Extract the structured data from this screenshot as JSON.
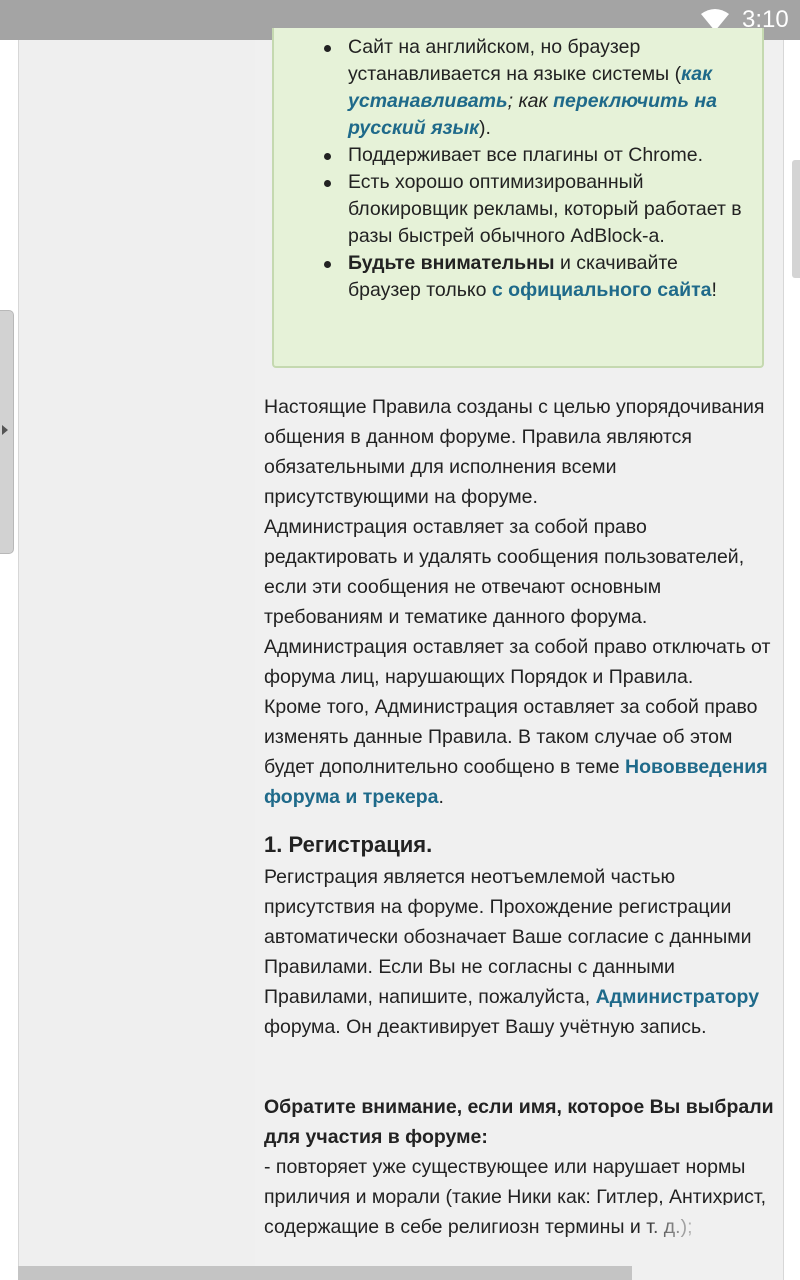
{
  "status_bar": {
    "time": "3:10"
  },
  "tip_box": {
    "item1": {
      "text_before": "Сайт на английском, но браузер устанавливается на языке системы (",
      "link1": "как устанавливать",
      "middle": "; как ",
      "link2": "переключить на русский язык",
      "after": ")."
    },
    "item2": "Поддерживает все плагины от Chrome.",
    "item3": "Есть хорошо оптимизированный блокировщик рекламы, который работает в разы быстрей обычного AdBlock-a.",
    "item4": {
      "bold": "Будьте внимательны",
      "text": " и скачивайте браузер только ",
      "link": "с официального сайта",
      "after": "!"
    }
  },
  "rules_intro": {
    "p1": "Настоящие Правила созданы с целью упорядочивания общения в данном форуме. Правила являются обязательными для исполнения всеми присутствующими на форуме.",
    "p2": "Администрация оставляет за собой право редактировать и удалять сообщения пользователей, если эти сообщения не отвечают основным требованиям и тематике данного форума.",
    "p3": "Администрация оставляет за собой право отключать от форума лиц, нарушающих Порядок и Правила.",
    "p4_text": "Кроме того, Администрация оставляет за собой право изменять данные Правила. В таком случае об этом будет дополнительно сообщено в теме ",
    "p4_link": "Нововведения форума и трекера",
    "p4_after": "."
  },
  "section1": {
    "title": "1. Регистрация.",
    "text_before": "Регистрация является неотъемлемой частью присутствия на форуме. Прохождение регистрации автоматически обозначает Ваше согласие с данными Правилами. Если Вы не согласны с данными Правилами, напишите, пожалуйста, ",
    "link": "Администратору",
    "text_after": " форума. Он деактивирует Вашу учётную запись."
  },
  "note": {
    "heading": "Обратите внимание, если имя, которое Вы выбрали для участия в форуме:",
    "item": "- повторяет уже существующее или нарушает нормы приличия и морали (такие Ники как: Гитлер, Антихрист, содержащие в себе религиозн термины и т. д.);"
  }
}
